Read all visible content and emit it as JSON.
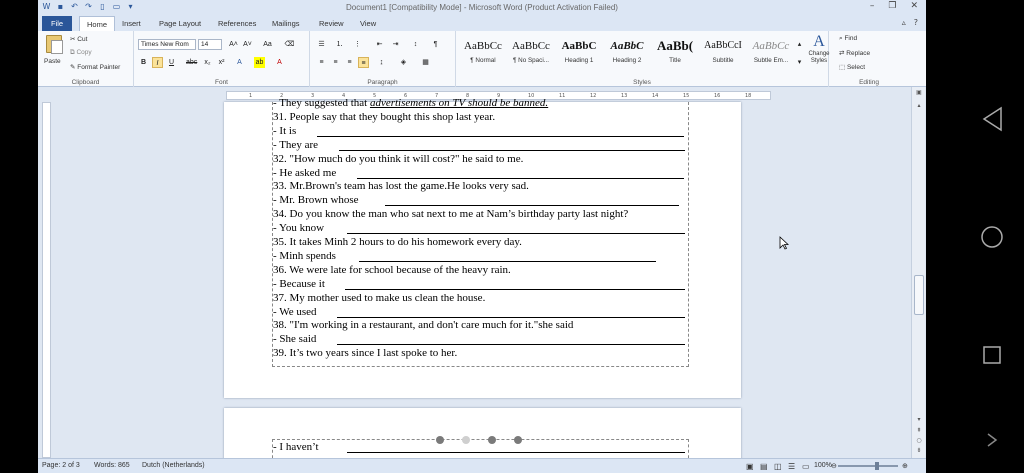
{
  "window": {
    "title": "Document1 [Compatibility Mode] - Microsoft Word (Product Activation Failed)"
  },
  "tabs": [
    "File",
    "Home",
    "Insert",
    "Page Layout",
    "References",
    "Mailings",
    "Review",
    "View"
  ],
  "active_tab": "Home",
  "clipboard": {
    "paste": "Paste",
    "cut": "Cut",
    "copy": "Copy",
    "format_painter": "Format Painter",
    "label": "Clipboard"
  },
  "font": {
    "name": "Times New Rom",
    "size": "14",
    "label": "Font"
  },
  "paragraph": {
    "label": "Paragraph"
  },
  "styles": {
    "label": "Styles",
    "items": [
      {
        "preview": "AaBbCc",
        "name": "¶ Normal"
      },
      {
        "preview": "AaBbCc",
        "name": "¶ No Spaci..."
      },
      {
        "preview": "AaBbC",
        "name": "Heading 1"
      },
      {
        "preview": "AaBbC",
        "name": "Heading 2"
      },
      {
        "preview": "AaBb(",
        "name": "Title"
      },
      {
        "preview": "AaBbCcI",
        "name": "Subtitle"
      },
      {
        "preview": "AaBbCc",
        "name": "Subtle Em..."
      }
    ],
    "change_styles": "Change Styles"
  },
  "editing": {
    "label": "Editing",
    "find": "Find",
    "replace": "Replace",
    "select": "Select"
  },
  "ruler_numbers": [
    "1",
    "2",
    "3",
    "4",
    "5",
    "6",
    "7",
    "8",
    "9",
    "10",
    "11",
    "12",
    "13",
    "14",
    "15",
    "16",
    "18"
  ],
  "document": {
    "page1_lines": [
      {
        "text": "-    They suggested that ",
        "italic": "advertisements on TV should be banned."
      },
      {
        "text": "31. People say that they bought this shop last year."
      },
      {
        "text": "-    It is"
      },
      {
        "text": "-    They are"
      },
      {
        "text": "32. \"How much do you think it will cost?\" he said to me."
      },
      {
        "text": "-    He asked me"
      },
      {
        "text": "33. Mr.Brown's team has lost the game.He looks very sad."
      },
      {
        "text": "-    Mr. Brown whose"
      },
      {
        "text": "34. Do you know the man who sat next to me at Nam’s birthday party last night?"
      },
      {
        "text": "-    You know"
      },
      {
        "text": "35. It takes Minh 2 hours to do his homework every day."
      },
      {
        "text": "-    Minh spends"
      },
      {
        "text": "36. We were late for school because of the heavy rain."
      },
      {
        "text": "-    Because it"
      },
      {
        "text": "37. My mother used to make us clean the house."
      },
      {
        "text": "-    We used"
      },
      {
        "text": "38. \"I'm working in a restaurant, and don't care much for it.\"she said"
      },
      {
        "text": "-    She said"
      },
      {
        "text": "39. It’s two years since I last spoke to her."
      }
    ],
    "page2_lines": [
      {
        "text": "-    I haven’t"
      }
    ]
  },
  "status": {
    "page": "Page: 2 of 3",
    "words": "Words: 865",
    "language": "Dutch (Netherlands)",
    "zoom": "100%"
  }
}
